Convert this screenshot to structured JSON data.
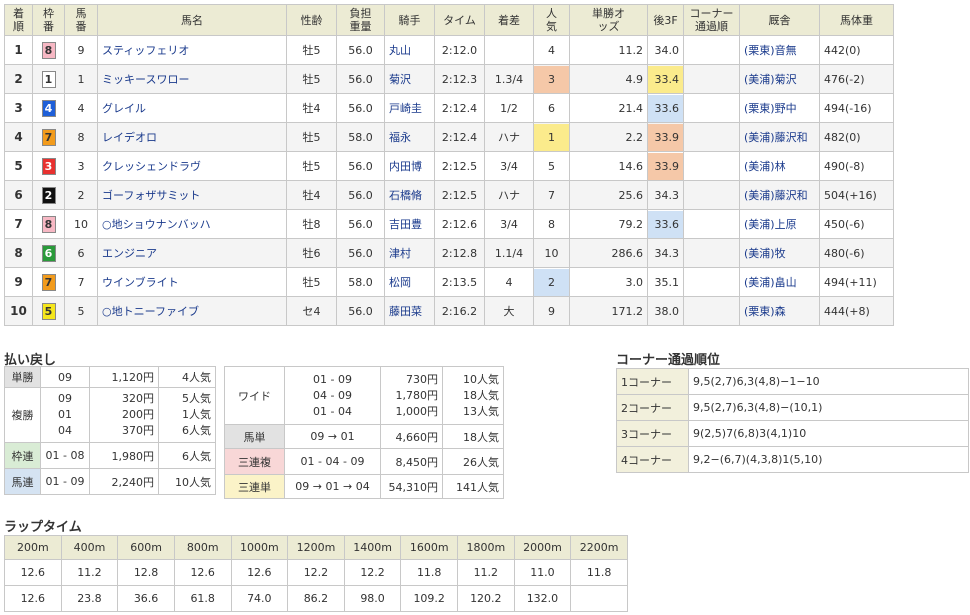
{
  "results": {
    "headers": {
      "rank": "着順",
      "waku": "枠番",
      "umaban": "馬番",
      "name": "馬名",
      "sexage": "性齢",
      "weight": "負担重量",
      "jockey": "騎手",
      "time": "タイム",
      "margin": "着差",
      "pop": "人気",
      "odds": "単勝オッズ",
      "f3": "後3F",
      "corner": "コーナー通過順",
      "trainer": "厩舎",
      "body": "馬体重"
    },
    "rows": [
      {
        "rank": "1",
        "waku": "8",
        "umaban": "9",
        "name": "スティッフェリオ",
        "sexage": "牡5",
        "weight": "56.0",
        "jockey": "丸山",
        "time": "2:12.0",
        "margin": "",
        "pop": "4",
        "odds": "11.2",
        "f3": "34.0",
        "corner": "",
        "trainer": "(栗東)音無",
        "body": "442(0)"
      },
      {
        "rank": "2",
        "waku": "1",
        "umaban": "1",
        "name": "ミッキースワロー",
        "sexage": "牡5",
        "weight": "56.0",
        "jockey": "菊沢",
        "time": "2:12.3",
        "margin": "1.3/4",
        "pop": "3",
        "odds": "4.9",
        "f3": "33.4",
        "corner": "",
        "trainer": "(美浦)菊沢",
        "body": "476(-2)"
      },
      {
        "rank": "3",
        "waku": "4",
        "umaban": "4",
        "name": "グレイル",
        "sexage": "牡4",
        "weight": "56.0",
        "jockey": "戸崎圭",
        "time": "2:12.4",
        "margin": "1/2",
        "pop": "6",
        "odds": "21.4",
        "f3": "33.6",
        "corner": "",
        "trainer": "(栗東)野中",
        "body": "494(-16)"
      },
      {
        "rank": "4",
        "waku": "7",
        "umaban": "8",
        "name": "レイデオロ",
        "sexage": "牡5",
        "weight": "58.0",
        "jockey": "福永",
        "time": "2:12.4",
        "margin": "ハナ",
        "pop": "1",
        "odds": "2.2",
        "f3": "33.9",
        "corner": "",
        "trainer": "(美浦)藤沢和",
        "body": "482(0)"
      },
      {
        "rank": "5",
        "waku": "3",
        "umaban": "3",
        "name": "クレッシェンドラヴ",
        "sexage": "牡5",
        "weight": "56.0",
        "jockey": "内田博",
        "time": "2:12.5",
        "margin": "3/4",
        "pop": "5",
        "odds": "14.6",
        "f3": "33.9",
        "corner": "",
        "trainer": "(美浦)林",
        "body": "490(-8)"
      },
      {
        "rank": "6",
        "waku": "2",
        "umaban": "2",
        "name": "ゴーフォザサミット",
        "sexage": "牡4",
        "weight": "56.0",
        "jockey": "石橋脩",
        "time": "2:12.5",
        "margin": "ハナ",
        "pop": "7",
        "odds": "25.6",
        "f3": "34.3",
        "corner": "",
        "trainer": "(美浦)藤沢和",
        "body": "504(+16)"
      },
      {
        "rank": "7",
        "waku": "8",
        "umaban": "10",
        "name": "○地ショウナンバッハ",
        "sexage": "牡8",
        "weight": "56.0",
        "jockey": "吉田豊",
        "time": "2:12.6",
        "margin": "3/4",
        "pop": "8",
        "odds": "79.2",
        "f3": "33.6",
        "corner": "",
        "trainer": "(美浦)上原",
        "body": "450(-6)"
      },
      {
        "rank": "8",
        "waku": "6",
        "umaban": "6",
        "name": "エンジニア",
        "sexage": "牡6",
        "weight": "56.0",
        "jockey": "津村",
        "time": "2:12.8",
        "margin": "1.1/4",
        "pop": "10",
        "odds": "286.6",
        "f3": "34.3",
        "corner": "",
        "trainer": "(美浦)牧",
        "body": "480(-6)"
      },
      {
        "rank": "9",
        "waku": "7",
        "umaban": "7",
        "name": "ウインブライト",
        "sexage": "牡5",
        "weight": "58.0",
        "jockey": "松岡",
        "time": "2:13.5",
        "margin": "4",
        "pop": "2",
        "odds": "3.0",
        "f3": "35.1",
        "corner": "",
        "trainer": "(美浦)畠山",
        "body": "494(+11)"
      },
      {
        "rank": "10",
        "waku": "5",
        "umaban": "5",
        "name": "○地トニーファイブ",
        "sexage": "セ4",
        "weight": "56.0",
        "jockey": "藤田菜",
        "time": "2:16.2",
        "margin": "大",
        "pop": "9",
        "odds": "171.2",
        "f3": "38.0",
        "corner": "",
        "trainer": "(栗東)森",
        "body": "444(+8)"
      }
    ]
  },
  "colors": {
    "waku": {
      "1": "#ffffff",
      "2": "#111111",
      "3": "#e8312f",
      "4": "#1e5fd8",
      "5": "#f5e61c",
      "6": "#2a9a3a",
      "7": "#f29b1c",
      "8": "#f7b8c4"
    },
    "waku_text": {
      "1": "#333333",
      "2": "#ffffff",
      "3": "#ffffff",
      "4": "#ffffff",
      "5": "#333333",
      "6": "#ffffff",
      "7": "#333333",
      "8": "#333333"
    },
    "pop": {
      "1": "#fbeb8c",
      "2": "#cfe1f5",
      "3": "#f5c8a8"
    },
    "f3": {
      "1": "#fbeb8c",
      "2": "#cfe1f5",
      "3": "#f5c8a8"
    }
  },
  "highlights": {
    "f3": {
      "33.4": "1",
      "33.6": "2",
      "33.9": "3"
    }
  },
  "payout": {
    "title": "払い戻し",
    "win": {
      "label": "単勝",
      "num": "09",
      "amount": "1,120円",
      "pop": "4人気"
    },
    "place": {
      "label": "複勝",
      "nums": [
        "09",
        "01",
        "04"
      ],
      "amounts": [
        "320円",
        "200円",
        "370円"
      ],
      "pops": [
        "5人気",
        "1人気",
        "6人気"
      ]
    },
    "wakuren": {
      "label": "枠連",
      "num": "01 - 08",
      "amount": "1,980円",
      "pop": "6人気"
    },
    "umaren": {
      "label": "馬連",
      "num": "01 - 09",
      "amount": "2,240円",
      "pop": "10人気"
    },
    "wide": {
      "label": "ワイド",
      "nums": [
        "01 - 09",
        "04 - 09",
        "01 - 04"
      ],
      "amounts": [
        "730円",
        "1,780円",
        "1,000円"
      ],
      "pops": [
        "10人気",
        "18人気",
        "13人気"
      ]
    },
    "umatan": {
      "label": "馬単",
      "num": "09 → 01",
      "amount": "4,660円",
      "pop": "18人気"
    },
    "trio": {
      "label": "三連複",
      "num": "01 - 04 - 09",
      "amount": "8,450円",
      "pop": "26人気"
    },
    "trifecta": {
      "label": "三連単",
      "num": "09 → 01 → 04",
      "amount": "54,310円",
      "pop": "141人気"
    }
  },
  "corner": {
    "title": "コーナー通過順位",
    "rows": [
      {
        "label": "1コーナー",
        "order": "9,5(2,7)6,3(4,8)−1−10"
      },
      {
        "label": "2コーナー",
        "order": "9,5(2,7)6,3(4,8)−(10,1)"
      },
      {
        "label": "3コーナー",
        "order": "9(2,5)7(6,8)3(4,1)10"
      },
      {
        "label": "4コーナー",
        "order": "9,2−(6,7)(4,3,8)1(5,10)"
      }
    ]
  },
  "laps": {
    "title": "ラップタイム",
    "headers": [
      "200m",
      "400m",
      "600m",
      "800m",
      "1000m",
      "1200m",
      "1400m",
      "1600m",
      "1800m",
      "2000m",
      "2200m"
    ],
    "lap": [
      "12.6",
      "11.2",
      "12.8",
      "12.6",
      "12.6",
      "12.2",
      "12.2",
      "11.8",
      "11.2",
      "11.0",
      "11.8"
    ],
    "cumulative": [
      "12.6",
      "23.8",
      "36.6",
      "61.8",
      "74.0",
      "86.2",
      "98.0",
      "109.2",
      "120.2",
      "132.0"
    ]
  }
}
